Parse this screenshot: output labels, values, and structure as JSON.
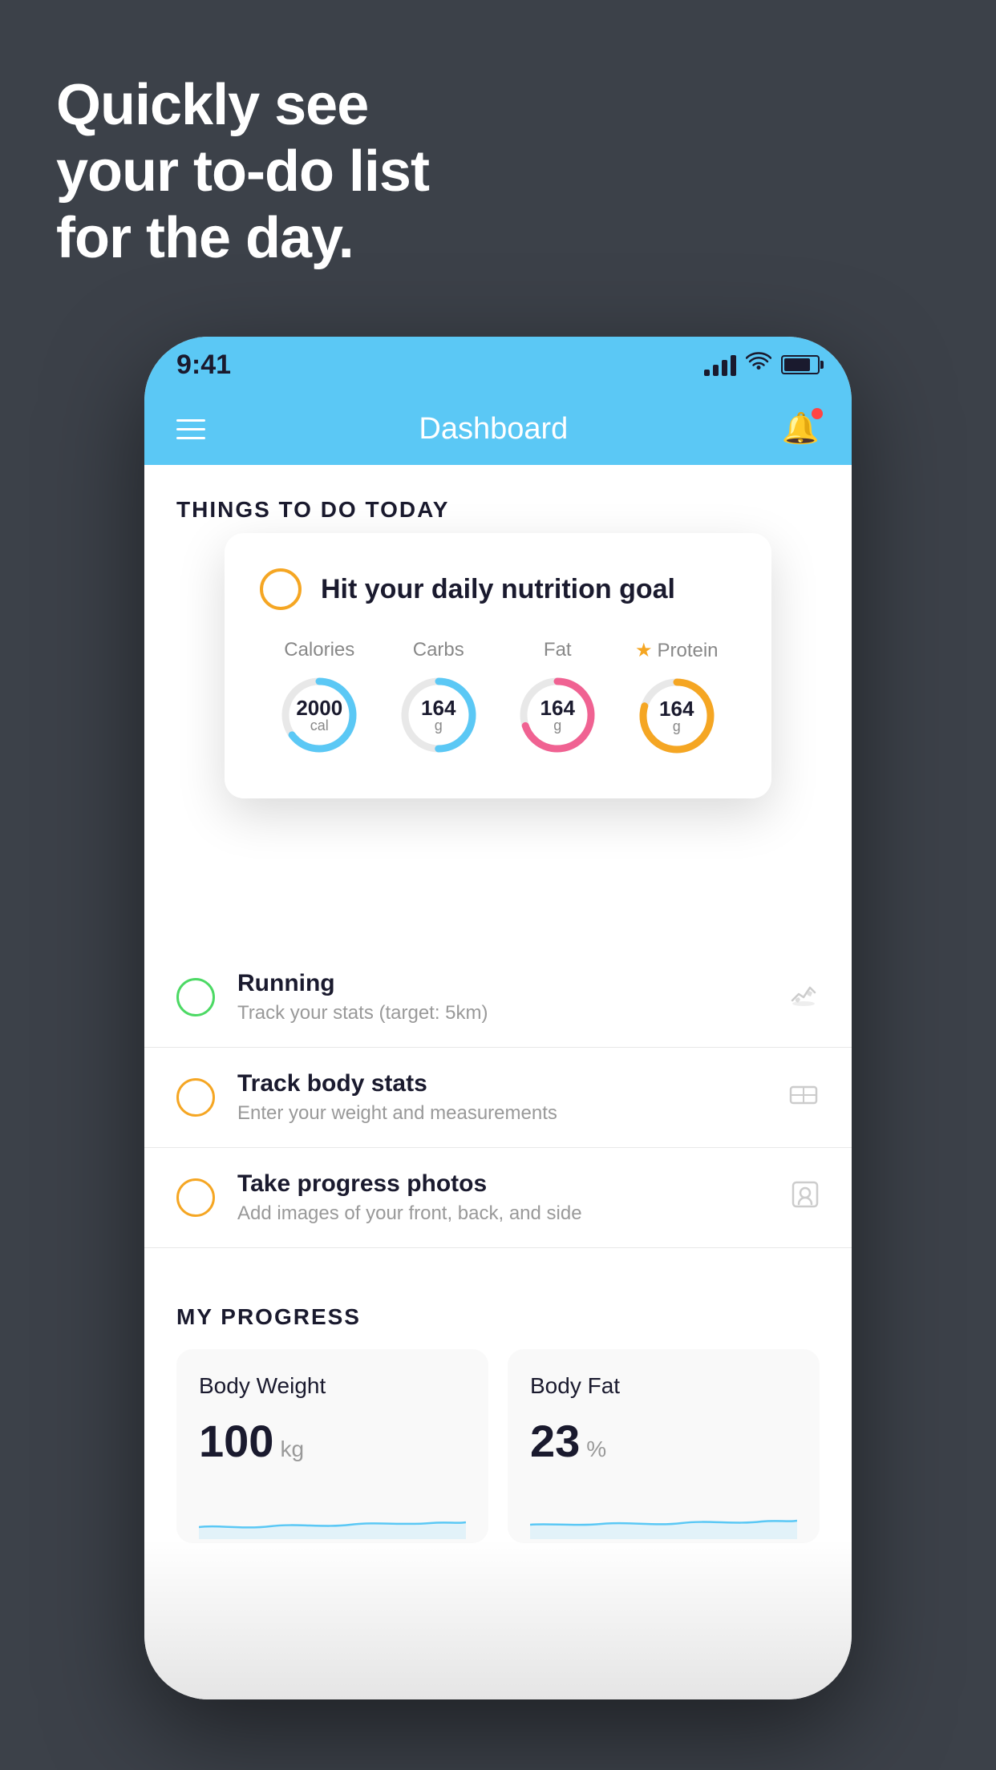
{
  "hero": {
    "line1": "Quickly see",
    "line2": "your to-do list",
    "line3": "for the day."
  },
  "statusBar": {
    "time": "9:41"
  },
  "header": {
    "title": "Dashboard"
  },
  "thingsToDo": {
    "sectionLabel": "THINGS TO DO TODAY"
  },
  "nutritionCard": {
    "circleEmpty": "",
    "title": "Hit your daily nutrition goal",
    "macros": [
      {
        "label": "Calories",
        "value": "2000",
        "unit": "cal",
        "color": "#5bc8f5",
        "percent": 65
      },
      {
        "label": "Carbs",
        "value": "164",
        "unit": "g",
        "color": "#5bc8f5",
        "percent": 50
      },
      {
        "label": "Fat",
        "value": "164",
        "unit": "g",
        "color": "#f06292",
        "percent": 70
      },
      {
        "label": "Protein",
        "value": "164",
        "unit": "g",
        "color": "#f5a623",
        "percent": 80,
        "star": true
      }
    ]
  },
  "todoItems": [
    {
      "circleColor": "green",
      "title": "Running",
      "subtitle": "Track your stats (target: 5km)",
      "icon": "👟"
    },
    {
      "circleColor": "yellow",
      "title": "Track body stats",
      "subtitle": "Enter your weight and measurements",
      "icon": "⚖️"
    },
    {
      "circleColor": "yellow",
      "title": "Take progress photos",
      "subtitle": "Add images of your front, back, and side",
      "icon": "👤"
    }
  ],
  "progressSection": {
    "label": "MY PROGRESS",
    "cards": [
      {
        "title": "Body Weight",
        "value": "100",
        "unit": "kg"
      },
      {
        "title": "Body Fat",
        "value": "23",
        "unit": "%"
      }
    ]
  }
}
